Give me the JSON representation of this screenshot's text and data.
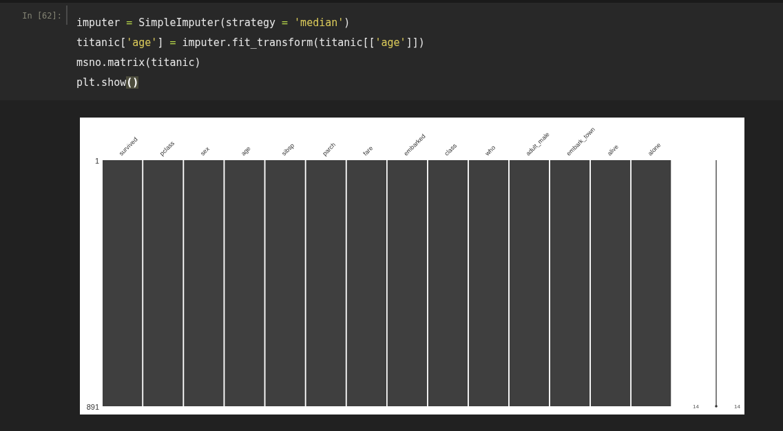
{
  "cell": {
    "prompt": "In [62]:",
    "lines": [
      [
        {
          "kind": "plain",
          "text": "imputer "
        },
        {
          "kind": "operator",
          "text": "="
        },
        {
          "kind": "plain",
          "text": " SimpleImputer(strategy "
        },
        {
          "kind": "operator",
          "text": "= "
        },
        {
          "kind": "string",
          "text": "'median'"
        },
        {
          "kind": "plain",
          "text": ")"
        }
      ],
      [
        {
          "kind": "plain",
          "text": "titanic["
        },
        {
          "kind": "string",
          "text": "'age'"
        },
        {
          "kind": "plain",
          "text": "] "
        },
        {
          "kind": "operator",
          "text": "="
        },
        {
          "kind": "plain",
          "text": " imputer.fit_transform(titanic[["
        },
        {
          "kind": "string",
          "text": "'age'"
        },
        {
          "kind": "plain",
          "text": "]])"
        }
      ],
      [
        {
          "kind": "plain",
          "text": "msno.matrix(titanic)"
        }
      ],
      [
        {
          "kind": "plain",
          "text": "plt.show"
        },
        {
          "kind": "matched_bracket",
          "text": "()"
        }
      ]
    ]
  },
  "output": {
    "matrix": {
      "columns": [
        {
          "label": "survived",
          "level": 1
        },
        {
          "label": "pclass",
          "level": 1
        },
        {
          "label": "sex",
          "level": 1
        },
        {
          "label": "age",
          "level": 1
        },
        {
          "label": "sibsp",
          "level": 1
        },
        {
          "label": "parch",
          "level": 1
        },
        {
          "label": "fare",
          "level": 1
        },
        {
          "label": "embarked",
          "level": 1
        },
        {
          "label": "class",
          "level": 1
        },
        {
          "label": "who",
          "level": 1
        },
        {
          "label": "adult_male",
          "level": 1
        },
        {
          "label": "embark_town",
          "level": 1
        },
        {
          "label": "alive",
          "level": 1
        },
        {
          "label": "alone",
          "level": 1
        }
      ],
      "row_labels": [
        "1",
        "891"
      ],
      "sparkline_labels": [
        "14",
        "14"
      ]
    }
  }
}
